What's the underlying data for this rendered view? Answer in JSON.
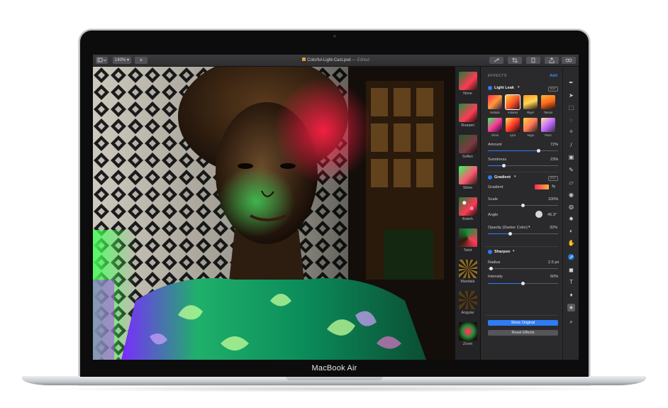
{
  "app": {
    "document_title": "Colorful-Light-Cast.pxd",
    "document_status": "— Edited",
    "zoom_level": "140%",
    "add_label": "+",
    "toolbar_icons": [
      "view-mode-icon",
      "share-icon",
      "crop-icon",
      "export-icon",
      "upload-icon",
      "adjust-icon"
    ]
  },
  "effects_browser": {
    "items": [
      {
        "label": "None"
      },
      {
        "label": "Sharpen"
      },
      {
        "label": "Soften"
      },
      {
        "label": "Shine"
      },
      {
        "label": "Bokeh"
      },
      {
        "label": "Twist"
      },
      {
        "label": "Mandala"
      },
      {
        "label": "Angular"
      },
      {
        "label": "Zoom"
      }
    ]
  },
  "effects_panel": {
    "header": "EFFECTS",
    "add_label": "Add",
    "light_leak": {
      "title": "Light Leak",
      "edit_label": "EDIT",
      "presets": [
        {
          "label": "Nebula"
        },
        {
          "label": "Antares"
        },
        {
          "label": "Rigel"
        },
        {
          "label": "Taurus"
        },
        {
          "label": "Orion"
        },
        {
          "label": "Lyra"
        },
        {
          "label": "Vega"
        },
        {
          "label": "Pavo"
        }
      ],
      "selected_preset": "Antares",
      "amount_label": "Amount",
      "amount_value": "72%",
      "amount_level": 0.72,
      "sunniness_label": "Sunniness",
      "sunniness_value": "23%",
      "sunniness_level": 0.23
    },
    "gradient": {
      "title": "Gradient",
      "edit_label": "EDIT",
      "gradient_label": "Gradient",
      "scale_label": "Scale",
      "scale_value": "100%",
      "scale_level": 0.5,
      "angle_label": "Angle",
      "angle_value": "45.3°",
      "opacity_label": "Opacity (Darker Color)",
      "opacity_value": "32%",
      "opacity_level": 0.32
    },
    "sharpen": {
      "title": "Sharpen",
      "radius_label": "Radius",
      "radius_value": "2.5 px",
      "radius_level": 0.05,
      "intensity_label": "Intensity",
      "intensity_value": "50%",
      "intensity_level": 0.5
    },
    "show_original_label": "Show Original",
    "reset_effects_label": "Reset Effects"
  },
  "tools": [
    "pen-icon",
    "pointer-icon",
    "selection-icon",
    "lasso-icon",
    "magic-wand-icon",
    "brush-icon",
    "fill-icon",
    "pencil-icon",
    "eraser-icon",
    "clone-icon",
    "blur-icon",
    "light-icon",
    "color-icon",
    "hand-icon",
    "path-icon",
    "shape-icon",
    "type-icon",
    "drop-icon",
    "effects-icon",
    "zoom-icon"
  ],
  "device": {
    "brand_label": "MacBook Air"
  },
  "colors": {
    "accent": "#2e7cf6",
    "panel_bg": "#2a2a2d",
    "toolbar_bg": "#333336"
  }
}
